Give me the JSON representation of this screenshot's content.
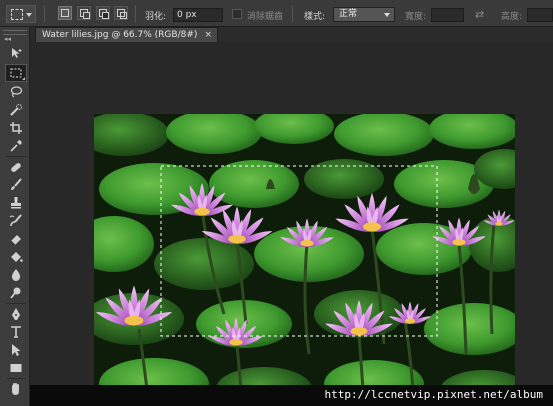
{
  "options_bar": {
    "feather_label": "羽化:",
    "feather_value": "0 px",
    "antialias_label": "消除鋸齒",
    "style_label": "樣式:",
    "style_value": "正常",
    "width_label": "寬度:",
    "height_label": "高度:"
  },
  "document": {
    "tab_title": "Water lilies.jpg @ 66.7% (RGB/8#)",
    "close_glyph": "×"
  },
  "toolbar": {
    "collapse_glyph": "◂◂",
    "tools": [
      "move-tool",
      "rectangular-marquee-tool",
      "lasso-tool",
      "quick-selection-tool",
      "crop-tool",
      "eyedropper-tool",
      "spot-healing-brush-tool",
      "brush-tool",
      "clone-stamp-tool",
      "history-brush-tool",
      "eraser-tool",
      "paint-bucket-tool",
      "blur-tool",
      "dodge-tool",
      "pen-tool",
      "type-tool",
      "path-selection-tool",
      "rectangle-tool",
      "hand-tool"
    ],
    "active_tool": "rectangular-marquee-tool"
  },
  "watermark": {
    "text": "http://lccnetvip.pixnet.net/album"
  },
  "colors": {
    "ui_dark": "#282828",
    "panel": "#3a3a3a",
    "lily_petal": "#c77ad6",
    "leaf": "#3c8f2c"
  }
}
